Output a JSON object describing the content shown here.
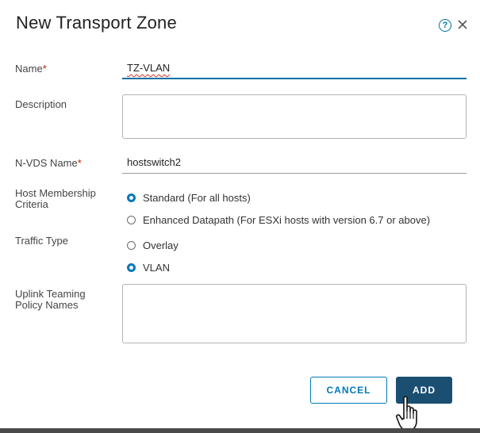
{
  "dialog": {
    "title": "New Transport Zone"
  },
  "icons": {
    "help": "question-circle-icon",
    "close": "close-icon",
    "cursor": "hand-pointer-cursor"
  },
  "fields": {
    "name": {
      "label": "Name",
      "required_mark": "*",
      "value": "TZ-VLAN"
    },
    "description": {
      "label": "Description",
      "value": ""
    },
    "nvds_name": {
      "label": "N-VDS Name",
      "required_mark": "*",
      "value": "hostswitch2"
    },
    "host_membership": {
      "label": "Host Membership Criteria",
      "options": [
        {
          "label": "Standard (For all hosts)",
          "checked": true
        },
        {
          "label": "Enhanced Datapath (For ESXi hosts with version 6.7 or above)",
          "checked": false
        }
      ]
    },
    "traffic_type": {
      "label": "Traffic Type",
      "options": [
        {
          "label": "Overlay",
          "checked": false
        },
        {
          "label": "VLAN",
          "checked": true
        }
      ]
    },
    "uplink_teaming": {
      "label": "Uplink Teaming Policy Names",
      "value": ""
    }
  },
  "buttons": {
    "cancel": "CANCEL",
    "add": "ADD"
  },
  "colors": {
    "accent": "#0079b8",
    "primary_button": "#1b4f72",
    "required": "#c21d00"
  }
}
